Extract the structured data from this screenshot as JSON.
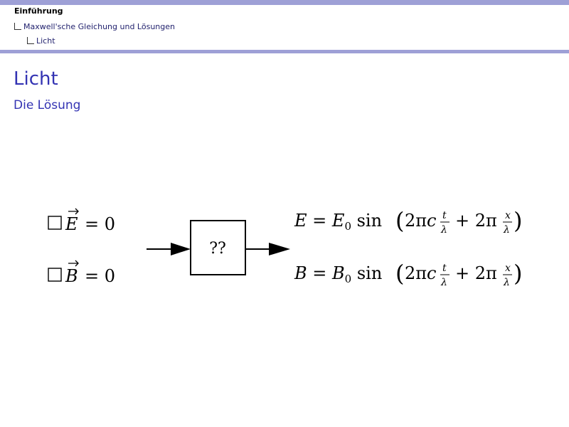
{
  "header": {
    "section": "Einführung",
    "subsection": "Maxwell'sche Gleichung und Lösungen",
    "frame": "Licht"
  },
  "slide": {
    "title": "Licht",
    "subtitle": "Die Lösung"
  },
  "diagram": {
    "box_label": "??"
  },
  "colors": {
    "header_bar": "#9ea0d6",
    "title": "#3333b3",
    "nav_text": "#22226e"
  }
}
